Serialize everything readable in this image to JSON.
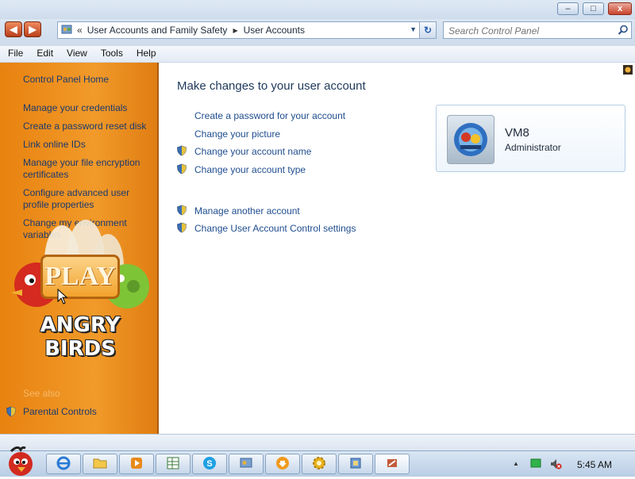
{
  "window": {
    "controls": {
      "minimize": "–",
      "maximize": "□",
      "close": "x"
    }
  },
  "address_bar": {
    "back_glyph": "◀",
    "forward_glyph": "▶",
    "chevron": "«",
    "breadcrumbs": [
      "User Accounts and Family Safety",
      "User Accounts"
    ],
    "separator": "▶",
    "dropdown_glyph": "▼",
    "refresh_glyph": "↻"
  },
  "search": {
    "placeholder": "Search Control Panel"
  },
  "menu": [
    "File",
    "Edit",
    "View",
    "Tools",
    "Help"
  ],
  "sidebar": {
    "home_link": "Control Panel Home",
    "links": [
      "Manage your credentials",
      "Create a password reset disk",
      "Link online IDs",
      "Manage your file encryption certificates",
      "Configure advanced user profile properties",
      "Change my environment variables"
    ],
    "see_also_heading": "See also",
    "see_also_links": [
      "Parental Controls"
    ],
    "overlay_game": {
      "play_label": "PLAY",
      "logo_text": "ANGRY BIRDS"
    }
  },
  "main": {
    "title": "Make changes to your user account",
    "tasks": [
      {
        "label": "Create a password for your account",
        "shield": false
      },
      {
        "label": "Change your picture",
        "shield": false
      },
      {
        "label": "Change your account name",
        "shield": true
      },
      {
        "label": "Change your account type",
        "shield": true
      }
    ],
    "other_tasks": [
      {
        "label": "Manage another account",
        "shield": true
      },
      {
        "label": "Change User Account Control settings",
        "shield": true
      }
    ]
  },
  "account": {
    "name": "VM8",
    "role": "Administrator"
  },
  "taskbar": {
    "items": [
      "internet-explorer-icon",
      "folder-icon",
      "media-player-icon",
      "spreadsheet-icon",
      "skype-icon",
      "control-panel-icon",
      "download-icon",
      "settings-gear-icon",
      "user-accounts-icon",
      "tools-icon"
    ],
    "tray_up_arrow": "▲",
    "time": "5:45 AM"
  },
  "colors": {
    "sidebar_orange": "#f19a2a",
    "link_blue": "#1f4d8f",
    "title_blue": "#1e395b"
  }
}
